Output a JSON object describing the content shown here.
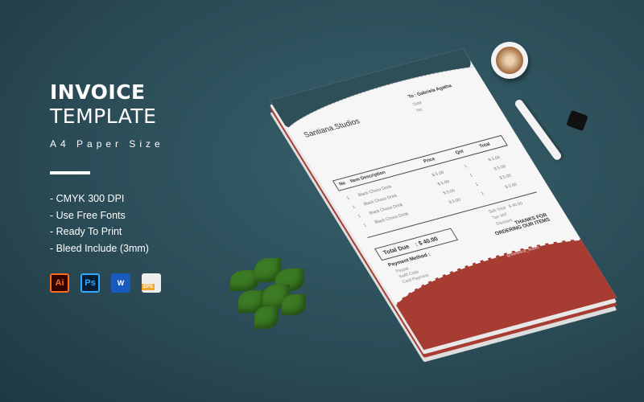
{
  "promo": {
    "title_line1": "INVOICE",
    "title_line2": "TEMPLATE",
    "subtitle": "A4 Paper Size",
    "features": [
      "- CMYK 300 DPI",
      "- Use Free Fonts",
      "- Ready To Print",
      "- Bleed Include (3mm)"
    ],
    "file_icons": [
      {
        "name": "illustrator-icon",
        "label": "Ai"
      },
      {
        "name": "photoshop-icon",
        "label": "Ps"
      },
      {
        "name": "word-icon",
        "label": "W"
      },
      {
        "name": "eps-icon",
        "label": "EPS"
      }
    ]
  },
  "invoice": {
    "brand": "Santiana.Studios",
    "to": "To : Gabriela Agatha",
    "date_label": "Date",
    "no_label": "No",
    "columns": [
      "No",
      "Item Description",
      "Price",
      "Qnt",
      "Total"
    ],
    "items": [
      {
        "no": "1",
        "desc": "Black Choco Drink",
        "price": "$ 5.00",
        "qty": "1",
        "total": "$ 5.00"
      },
      {
        "no": "1",
        "desc": "Black Choco Drink",
        "price": "$ 5.00",
        "qty": "1",
        "total": "$ 5.00"
      },
      {
        "no": "1",
        "desc": "Black Choco Drink",
        "price": "$ 5.00",
        "qty": "1",
        "total": "$ 5.00"
      },
      {
        "no": "1",
        "desc": "Black Choco Drink",
        "price": "$ 5.00",
        "qty": "1",
        "total": "$ 5.00"
      }
    ],
    "sub_total_label": "Sub Total",
    "tax_label": "Tax VAT",
    "discount_label": "Discount",
    "sub_total": "$ 40.00",
    "total_due_label": "Total Due",
    "total_due": ": $ 40.00",
    "payment_label": "Payment Method :",
    "payment_methods": [
      "Paypal",
      "Swift Code",
      "Card Payment"
    ],
    "thanks": "THANKS FOR ORDERING OUR ITEMS",
    "social": "@santiana_studio",
    "colors": {
      "header": "#2e4e58",
      "footer": "#a63c32"
    }
  }
}
